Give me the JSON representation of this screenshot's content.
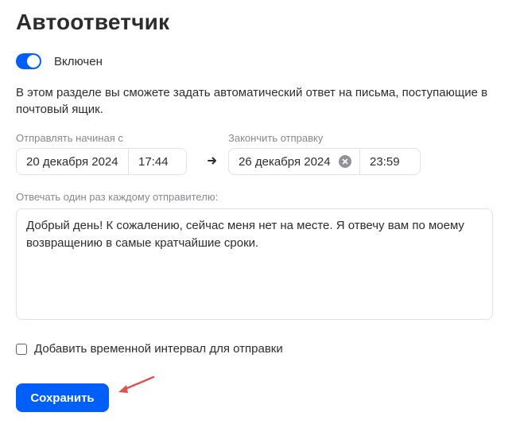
{
  "title": "Автоответчик",
  "toggle": {
    "label": "Включен",
    "on": true,
    "color": "#005ff9"
  },
  "description": "В этом разделе вы сможете задать автоматический ответ на письма, поступающие в почтовый ящик.",
  "start": {
    "label": "Отправлять начиная с",
    "date": "20 декабря 2024",
    "time": "17:44"
  },
  "end": {
    "label": "Закончить отправку",
    "date": "26 декабря 2024",
    "time": "23:59"
  },
  "reply": {
    "label": "Отвечать один раз каждому отправителю:",
    "text": "Добрый день! К сожалению, сейчас меня нет на месте. Я отвечу вам по моему возвращению в самые кратчайшие сроки."
  },
  "interval": {
    "label": "Добавить временной интервал для отправки",
    "checked": false
  },
  "save_button": {
    "label": "Сохранить",
    "color": "#005ff9"
  },
  "icons": {
    "arrow": "arrow-right-icon",
    "clear": "clear-circle-icon",
    "annotation": "red-pointer-arrow-icon"
  },
  "annotation_color": "#d9534f"
}
